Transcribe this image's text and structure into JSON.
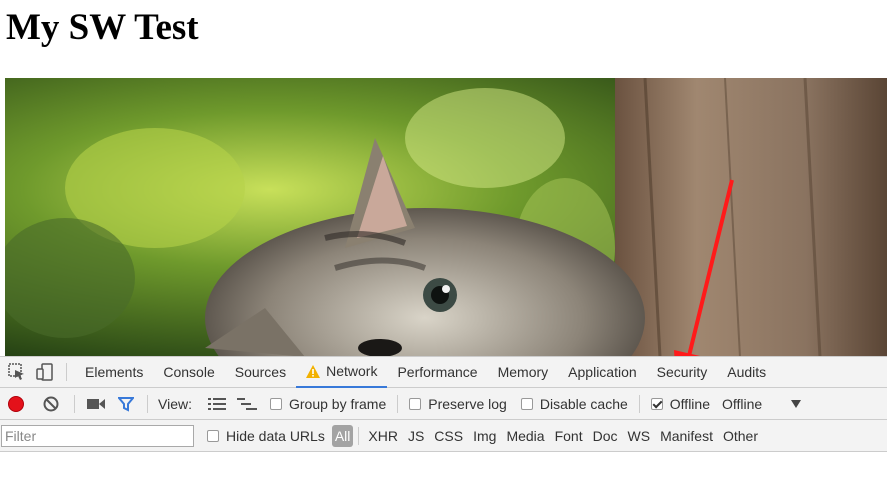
{
  "page": {
    "title": "My SW Test"
  },
  "devtools": {
    "tabs": [
      "Elements",
      "Console",
      "Sources",
      "Network",
      "Performance",
      "Memory",
      "Application",
      "Security",
      "Audits"
    ],
    "active_tab": "Network",
    "toolbar": {
      "view_label": "View:",
      "group_by_frame": "Group by frame",
      "preserve_log": "Preserve log",
      "disable_cache": "Disable cache",
      "offline_checkbox": "Offline",
      "offline_checked": true,
      "throttle_value": "Offline"
    },
    "filterbar": {
      "filter_placeholder": "Filter",
      "hide_data_urls": "Hide data URLs",
      "types": [
        "All",
        "XHR",
        "JS",
        "CSS",
        "Img",
        "Media",
        "Font",
        "Doc",
        "WS",
        "Manifest",
        "Other"
      ]
    }
  },
  "colors": {
    "record": "#e4111a",
    "accent": "#3879d9",
    "arrow": "#ff1a1a"
  }
}
